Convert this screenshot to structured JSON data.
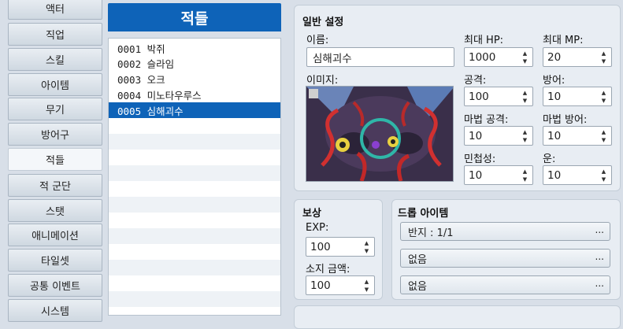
{
  "categories": [
    "액터",
    "직업",
    "스킬",
    "아이템",
    "무기",
    "방어구",
    "적들",
    "적 군단",
    "스탯",
    "애니메이션",
    "타일셋",
    "공통 이벤트",
    "시스템"
  ],
  "active_category": "적들",
  "list": {
    "title": "적들",
    "items": [
      "0001 박쥐",
      "0002 슬라임",
      "0003 오크",
      "0004 미노타우루스",
      "0005 심해괴수"
    ],
    "selected_index": 4
  },
  "general": {
    "title": "일반 설정",
    "name_label": "이름:",
    "name_value": "심해괴수",
    "image_label": "이미지:",
    "maxhp_label": "최대 HP:",
    "maxhp_value": "1000",
    "maxmp_label": "최대 MP:",
    "maxmp_value": "20",
    "attack_label": "공격:",
    "attack_value": "100",
    "defense_label": "방어:",
    "defense_value": "10",
    "mattack_label": "마법 공격:",
    "mattack_value": "10",
    "mdefense_label": "마법 방어:",
    "mdefense_value": "10",
    "agility_label": "민첩성:",
    "agility_value": "10",
    "luck_label": "운:",
    "luck_value": "10"
  },
  "reward": {
    "title": "보상",
    "exp_label": "EXP:",
    "exp_value": "100",
    "gold_label": "소지 금액:",
    "gold_value": "100"
  },
  "drops": {
    "title": "드롭 아이템",
    "items": [
      "반지 : 1/1",
      "없음",
      "없음"
    ],
    "more": "..."
  },
  "colors": {
    "accent": "#0e63b8",
    "panel": "#e8edf3"
  }
}
